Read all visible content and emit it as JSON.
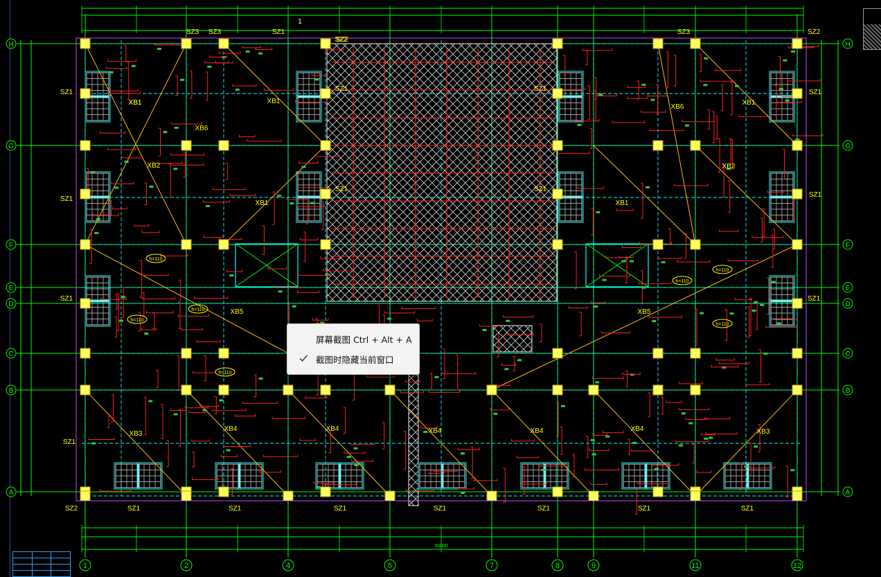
{
  "context_menu": {
    "item_screenshot": "屏幕截图 Ctrl + Alt + A",
    "item_hide_window": "截图时隐藏当前窗口",
    "item_hide_window_checked": true
  },
  "drawing": {
    "axis_columns": [
      "1",
      "2",
      "4",
      "6",
      "7",
      "8",
      "9",
      "11",
      "12"
    ],
    "axis_rows": [
      "H",
      "G",
      "F",
      "E",
      "D",
      "C",
      "B",
      "A"
    ],
    "column_labels_top": [
      "SZ3",
      "SZ3",
      "SZ1",
      "SZ2",
      "SZ3",
      "SZ2"
    ],
    "column_labels_bottom": [
      "SZ2",
      "SZ1",
      "SZ1",
      "SZ1",
      "SZ1",
      "SZ1",
      "SZ1",
      "SZ1"
    ],
    "left_labels": [
      "SZ1",
      "SZ1",
      "SZ1",
      "SZ1"
    ],
    "right_labels": [
      "SZ1",
      "SZ1",
      "SZ1"
    ],
    "mid_labels": [
      "SZ1",
      "SZ1",
      "SZ1",
      "SZ1",
      "SZ2"
    ],
    "slab_labels": [
      "XB1",
      "XB1",
      "XB6",
      "XB2",
      "XB1",
      "XB1",
      "XB6",
      "XB1",
      "XB2",
      "XB1",
      "XB5",
      "XB5",
      "XB3",
      "XB4",
      "XB4",
      "XB4",
      "XB4",
      "XB4",
      "XB3"
    ],
    "slab_thickness_tags": [
      "h=110",
      "h=110",
      "h=110",
      "h=110",
      "h=110",
      "h=110",
      "h=110"
    ],
    "dim_bottom_total": "56000",
    "section_marker": "1"
  },
  "colors": {
    "background": "#000000",
    "axis_line": "#00ff00",
    "grid_dashed": "#00ffff",
    "rebar": "#ff2020",
    "slab_diag": "#ffc000",
    "column_fill": "#ffff60",
    "label_yellow": "#ffff00",
    "menu_bg": "#f3f3f3"
  }
}
